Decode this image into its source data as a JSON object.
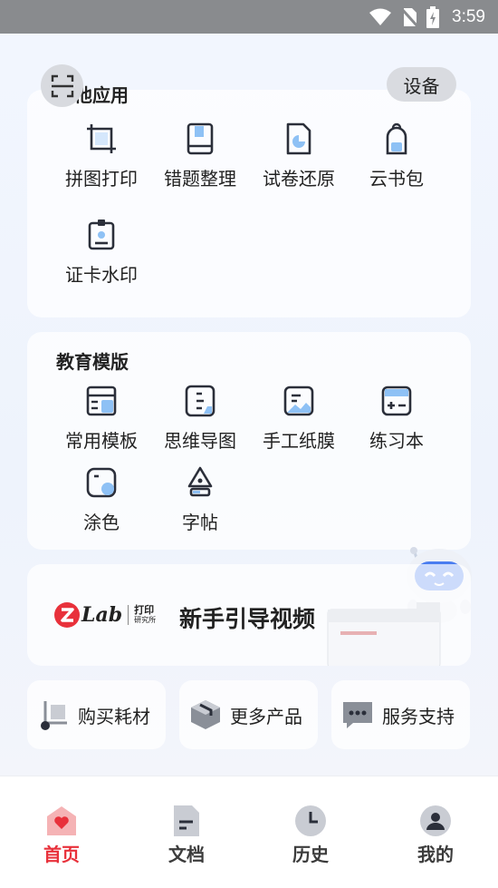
{
  "status_bar": {
    "time": "3:59"
  },
  "header": {
    "device_label": "设备"
  },
  "other_apps": {
    "title": "其他应用",
    "items": [
      {
        "label": "拼图打印",
        "icon": "crop-icon"
      },
      {
        "label": "错题整理",
        "icon": "book-icon"
      },
      {
        "label": "试卷还原",
        "icon": "document-pie-icon"
      },
      {
        "label": "云书包",
        "icon": "backpack-icon"
      },
      {
        "label": "证卡水印",
        "icon": "id-card-icon"
      }
    ]
  },
  "education": {
    "title": "教育模版",
    "items": [
      {
        "label": "常用模板",
        "icon": "template-icon"
      },
      {
        "label": "思维导图",
        "icon": "mindmap-icon"
      },
      {
        "label": "手工纸膜",
        "icon": "image-paper-icon"
      },
      {
        "label": "练习本",
        "icon": "math-notebook-icon"
      },
      {
        "label": "涂色",
        "icon": "coloring-icon"
      },
      {
        "label": "字帖",
        "icon": "pen-nib-icon"
      }
    ]
  },
  "banner": {
    "logo_text": "Lab",
    "logo_sub_top": "打印",
    "logo_sub_bottom": "研究所",
    "headline": "新手引导视频"
  },
  "quick_links": [
    {
      "label": "购买耗材",
      "icon": "cart-icon"
    },
    {
      "label": "更多产品",
      "icon": "box-icon"
    },
    {
      "label": "服务支持",
      "icon": "chat-icon"
    }
  ],
  "tabs": [
    {
      "label": "首页",
      "icon": "home-icon",
      "active": true
    },
    {
      "label": "文档",
      "icon": "document-icon",
      "active": false
    },
    {
      "label": "历史",
      "icon": "clock-icon",
      "active": false
    },
    {
      "label": "我的",
      "icon": "user-icon",
      "active": false
    }
  ],
  "colors": {
    "accent": "#e8313b",
    "icon_blue": "#8ec1f5",
    "icon_dark": "#2b2f3a"
  }
}
